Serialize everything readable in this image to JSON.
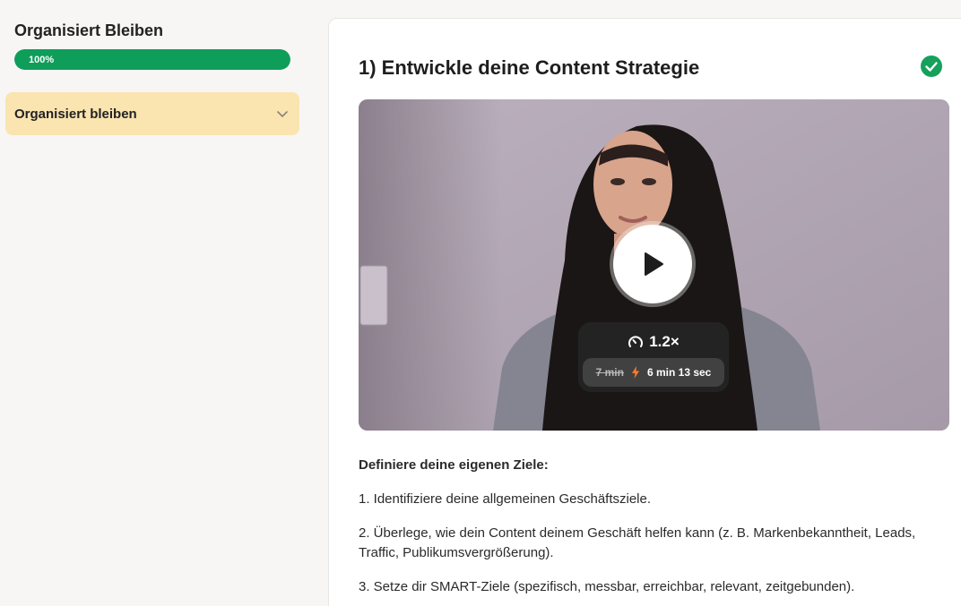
{
  "sidebar": {
    "course_title": "Organisiert Bleiben",
    "progress_label": "100%",
    "progress_value": 1.0,
    "module_label": "Organisiert bleiben"
  },
  "lesson": {
    "title": "1) Entwickle deine Content Strategie",
    "completed": true
  },
  "video": {
    "speed": "1.2×",
    "original_duration": "7 min",
    "adjusted_duration": "6 min 13 sec"
  },
  "content": {
    "heading": "Definiere deine eigenen Ziele:",
    "items": [
      "1. Identifiziere deine allgemeinen Geschäftsziele.",
      "2. Überlege, wie dein Content deinem Geschäft helfen kann (z. B. Markenbekanntheit, Leads, Traffic, Publikumsvergrößerung).",
      "3. Setze dir SMART-Ziele (spezifisch, messbar, erreichbar, relevant, zeitgebunden)."
    ]
  },
  "colors": {
    "accent_green": "#0f9d5a",
    "module_bg": "#fae4b0",
    "check_green": "#16a05c"
  },
  "icons": {
    "module_toggle": "chevron-down-icon",
    "completion": "check-circle-icon",
    "play": "play-icon",
    "speed": "speedometer-icon",
    "fast": "lightning-icon"
  }
}
